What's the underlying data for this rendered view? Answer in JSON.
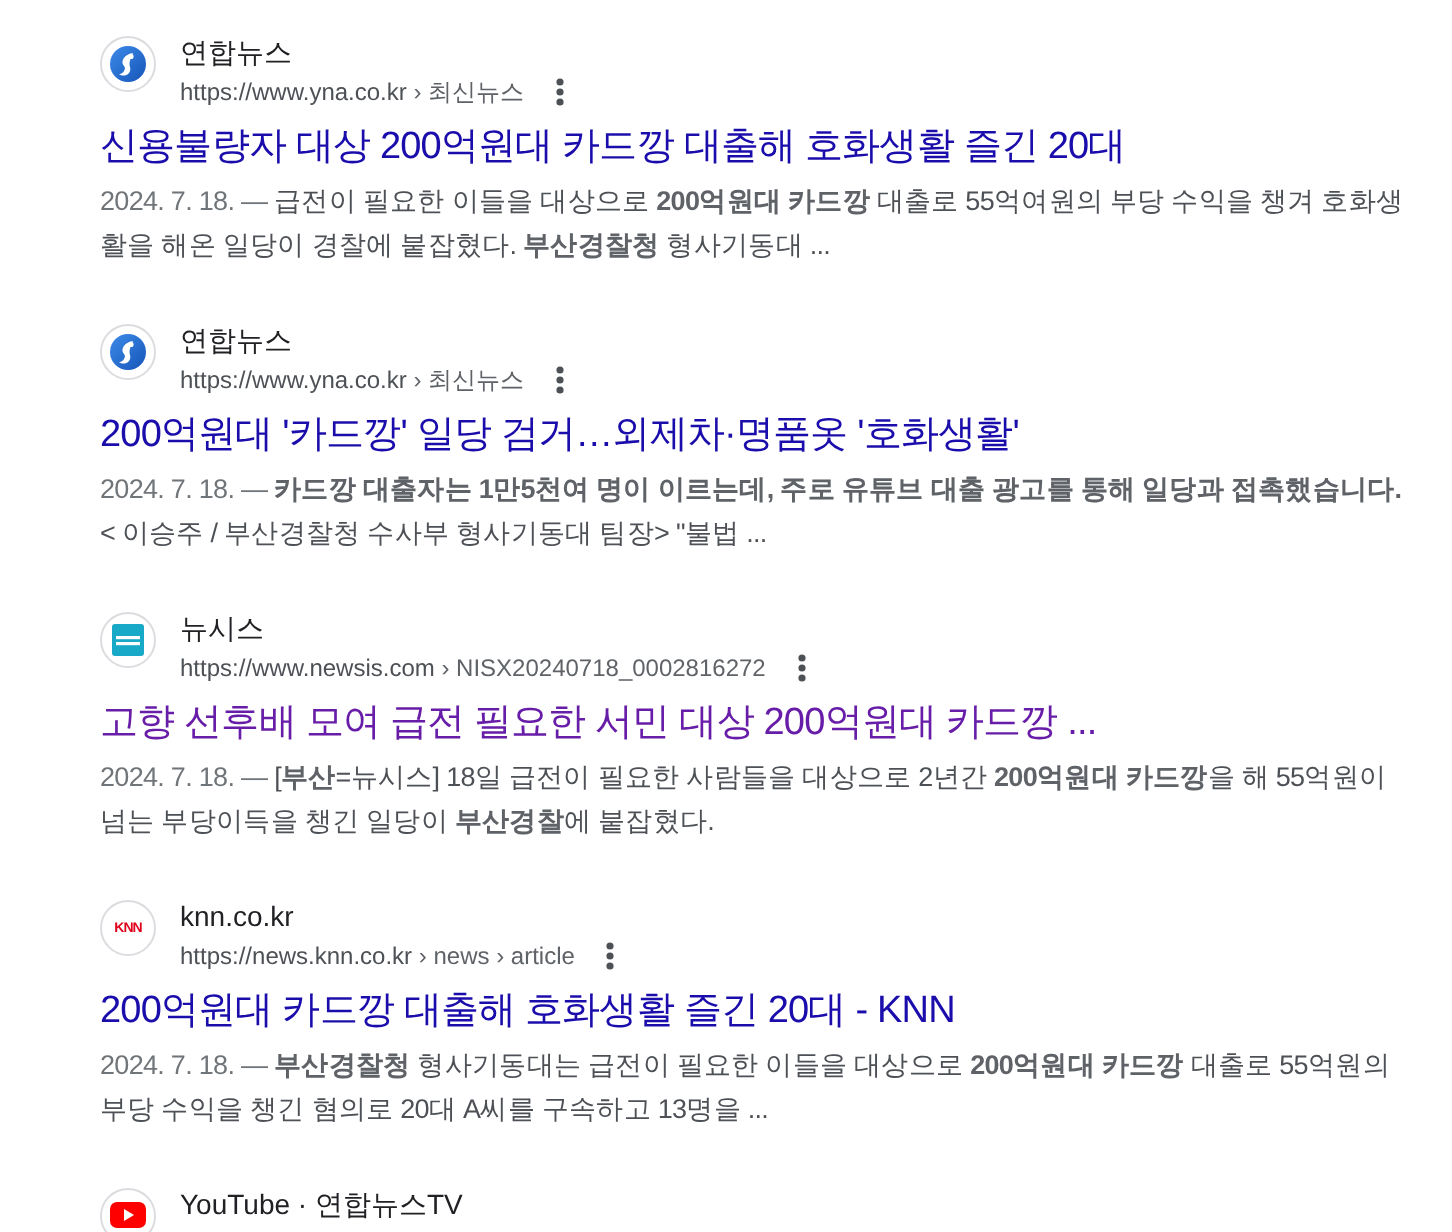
{
  "results": [
    {
      "favicon": {
        "kind": "blue-swirl"
      },
      "site_name": "연합뉴스",
      "url": "https://www.yna.co.kr",
      "path": "› 최신뉴스",
      "title": "신용불량자 대상 200억원대 카드깡 대출해 호화생활 즐긴 20대",
      "visited": false,
      "date": "2024. 7. 18. —",
      "snippet": "급전이 필요한 이들을 대상으로 **200억원대 카드깡** 대출로 55억여원의 부당 수익을 챙겨 호화생활을 해온 일당이 경찰에 붙잡혔다. **부산경찰청** 형사기동대 ..."
    },
    {
      "favicon": {
        "kind": "blue-swirl"
      },
      "site_name": "연합뉴스",
      "url": "https://www.yna.co.kr",
      "path": "› 최신뉴스",
      "title": "200억원대 '카드깡' 일당 검거…외제차·명품옷 '호화생활'",
      "visited": false,
      "date": "2024. 7. 18. —",
      "snippet": "**카드깡 대출자는 1만5천여 명이 이르는데, 주로 유튜브 대출 광고를 통해 일당과 접촉했습니다.** < 이승주 / 부산경찰청 수사부 형사기동대 팀장> \"불법 ..."
    },
    {
      "favicon": {
        "kind": "teal-tile"
      },
      "site_name": "뉴시스",
      "url": "https://www.newsis.com",
      "path": "› NISX20240718_0002816272",
      "title": "고향 선후배 모여 급전 필요한 서민 대상 200억원대 카드깡 ...",
      "visited": true,
      "date": "2024. 7. 18. —",
      "snippet": "[**부산**=뉴시스] 18일 급전이 필요한 사람들을 대상으로 2년간 **200억원대 카드깡**을 해 55억원이 넘는 부당이득을 챙긴 일당이 **부산경찰**에 붙잡혔다."
    },
    {
      "favicon": {
        "kind": "red-text",
        "text": "KNN"
      },
      "site_name": "knn.co.kr",
      "url": "https://news.knn.co.kr",
      "path": "› news › article",
      "title": "200억원대 카드깡 대출해 호화생활 즐긴 20대 - KNN",
      "visited": false,
      "date": "2024. 7. 18. —",
      "snippet": "**부산경찰청** 형사기동대는 급전이 필요한 이들을 대상으로 **200억원대 카드깡** 대출로 55억원의 부당 수익을 챙긴 혐의로 20대 A씨를 구속하고 13명을 ..."
    },
    {
      "favicon": {
        "kind": "red-play"
      },
      "site_name": "YouTube · 연합뉴스TV"
    }
  ]
}
